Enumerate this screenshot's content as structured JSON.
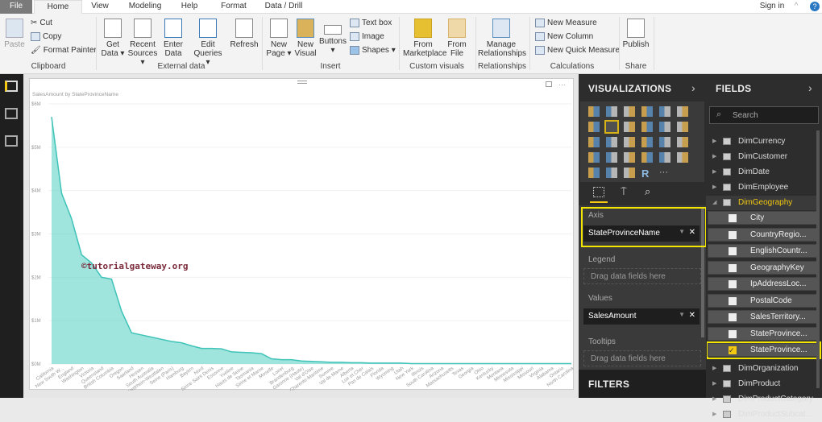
{
  "menu": {
    "tabs": [
      "File",
      "Home",
      "View",
      "Modeling",
      "Help",
      "Format",
      "Data / Drill"
    ],
    "sign_in": "Sign in"
  },
  "ribbon": {
    "clipboard": {
      "paste": "Paste",
      "cut": "Cut",
      "copy": "Copy",
      "format_painter": "Format Painter",
      "group": "Clipboard"
    },
    "external": {
      "get_data": "Get Data ▾",
      "recent_sources": "Recent Sources ▾",
      "enter_data": "Enter Data",
      "edit_queries": "Edit Queries ▾",
      "refresh": "Refresh",
      "group": "External data"
    },
    "insert": {
      "new_page": "New Page ▾",
      "new_visual": "New Visual",
      "buttons": "Buttons ▾",
      "text_box": "Text box",
      "image": "Image",
      "shapes": "Shapes ▾",
      "group": "Insert"
    },
    "custom": {
      "from_marketplace": "From Marketplace",
      "from_file": "From File",
      "group": "Custom visuals"
    },
    "relationships": {
      "manage": "Manage Relationships",
      "group": "Relationships"
    },
    "calculations": {
      "new_measure": "New Measure",
      "new_column": "New Column",
      "new_quick_measure": "New Quick Measure",
      "group": "Calculations"
    },
    "share": {
      "publish": "Publish",
      "group": "Share"
    }
  },
  "visualizations": {
    "title": "VISUALIZATIONS",
    "selected": "area-chart",
    "icons": [
      "stacked-bar",
      "stacked-column",
      "clustered-bar",
      "clustered-column",
      "100-stacked-bar",
      "100-stacked-column",
      "line-chart",
      "area-chart",
      "stacked-area",
      "line-column",
      "line-clustered-column",
      "ribbon-chart",
      "waterfall",
      "scatter",
      "pie",
      "donut",
      "treemap",
      "map",
      "filled-map",
      "funnel",
      "gauge",
      "card",
      "multi-row-card",
      "kpi",
      "slicer",
      "table",
      "matrix",
      "r-visual",
      "more"
    ],
    "wells": {
      "axis_label": "Axis",
      "axis_value": "StateProvinceName",
      "legend_label": "Legend",
      "legend_placeholder": "Drag data fields here",
      "values_label": "Values",
      "values_value": "SalesAmount",
      "tooltips_label": "Tooltips",
      "tooltips_placeholder": "Drag data fields here"
    },
    "filters": "FILTERS"
  },
  "fields": {
    "title": "FIELDS",
    "search_placeholder": "Search",
    "tables_top": [
      "DimCurrency",
      "DimCustomer",
      "DimDate",
      "DimEmployee"
    ],
    "expanded": "DimGeography",
    "columns": [
      {
        "name": "City",
        "checked": false
      },
      {
        "name": "CountryRegio...",
        "checked": false
      },
      {
        "name": "EnglishCountr...",
        "checked": false
      },
      {
        "name": "GeographyKey",
        "checked": false
      },
      {
        "name": "IpAddressLoc...",
        "checked": false
      },
      {
        "name": "PostalCode",
        "checked": false
      },
      {
        "name": "SalesTerritory...",
        "checked": false
      },
      {
        "name": "StateProvince...",
        "checked": false
      },
      {
        "name": "StateProvince...",
        "checked": true
      }
    ],
    "tables_bottom": [
      "DimOrganization",
      "DimProduct",
      "DimProductCategory",
      "DimProductSubcat..."
    ]
  },
  "watermark": "©tutorialgateway.org",
  "chart_data": {
    "type": "area",
    "title": "SalesAmount by StateProvinceName",
    "xlabel": "",
    "ylabel": "",
    "ylim": [
      0,
      6
    ],
    "y_unit": "$M",
    "yticks": [
      "$0M",
      "$1M",
      "$2M",
      "$3M",
      "$4M",
      "$5M",
      "$6M"
    ],
    "grid": true,
    "color": "#5fd3c7",
    "categories": [
      "California",
      "New South W...",
      "England",
      "Washington",
      "Victoria",
      "Queensland",
      "British Columbia",
      "Oregon",
      "Saarland",
      "Hessen",
      "South Australia",
      "Nordrhein-Westfalen",
      "Seine (Paris)",
      "Hamburg",
      "Bayern",
      "Nord",
      "Seine Saint Denis",
      "Essonne",
      "Yveline",
      "Hauts de Seine",
      "Tasmania",
      "Seine et Marne",
      "Moselle",
      "Loiret",
      "Brandenburg",
      "Garonne (Haute)",
      "Val d'Oise",
      "Charente-Maritime",
      "Somme",
      "Val de Marne",
      "Alberta",
      "Loir et Cher",
      "Pas de Calais",
      "Florida",
      "Wyoming",
      "Utah",
      "New York",
      "Illinois",
      "South Carolina",
      "Arizona",
      "Massachusetts",
      "Texas",
      "Georgia",
      "Ohio",
      "Kentucky",
      "Montana",
      "Minnesota",
      "Mississippi",
      "Missouri",
      "Virginia",
      "Alabama",
      "Ontario",
      "North Carolina"
    ],
    "values": [
      5.7,
      3.94,
      3.35,
      2.52,
      2.33,
      2.0,
      1.96,
      1.22,
      0.72,
      0.67,
      0.62,
      0.57,
      0.52,
      0.49,
      0.42,
      0.36,
      0.36,
      0.35,
      0.28,
      0.27,
      0.26,
      0.24,
      0.12,
      0.1,
      0.1,
      0.07,
      0.06,
      0.05,
      0.04,
      0.04,
      0.03,
      0.03,
      0.02,
      0.02,
      0.02,
      0.02,
      0.01,
      0.01,
      0.01,
      0.01,
      0.01,
      0.01,
      0.01,
      0.01,
      0.01,
      0.01,
      0.01,
      0.01,
      0.01,
      0.01,
      0.01,
      0.01,
      0.01
    ]
  }
}
